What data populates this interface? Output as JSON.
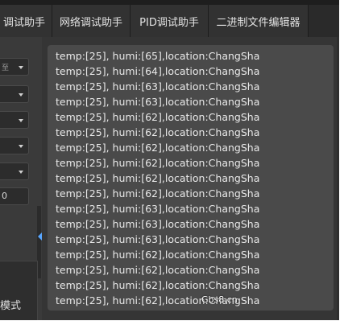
{
  "tabs": [
    {
      "label": "调试助手"
    },
    {
      "label": "网络调试助手"
    },
    {
      "label": "PID调试助手"
    },
    {
      "label": "二进制文件编辑器"
    }
  ],
  "sidebar": {
    "combo_first_text": "至",
    "input_text": "0",
    "mode_label": "模式"
  },
  "receive": {
    "lines": [
      "temp:[25], humi:[65],location:ChangSha",
      "temp:[25], humi:[64],location:ChangSha",
      "temp:[25], humi:[63],location:ChangSha",
      "temp:[25], humi:[63],location:ChangSha",
      "temp:[25], humi:[62],location:ChangSha",
      "temp:[25], humi:[62],location:ChangSha",
      "temp:[25], humi:[62],location:ChangSha",
      "temp:[25], humi:[62],location:ChangSha",
      "temp:[25], humi:[62],location:ChangSha",
      "temp:[25], humi:[62],location:ChangSha",
      "temp:[25], humi:[63],location:ChangSha",
      "temp:[25], humi:[63],location:ChangSha",
      "temp:[25], humi:[63],location:ChangSha",
      "temp:[25], humi:[62],location:ChangSha",
      "temp:[25], humi:[62],location:ChangSha",
      "temp:[25], humi:[62],location:ChangSha",
      "temp:[25], humi:[62],location:ChangSha"
    ]
  },
  "watermark": "Gbs8.cn"
}
